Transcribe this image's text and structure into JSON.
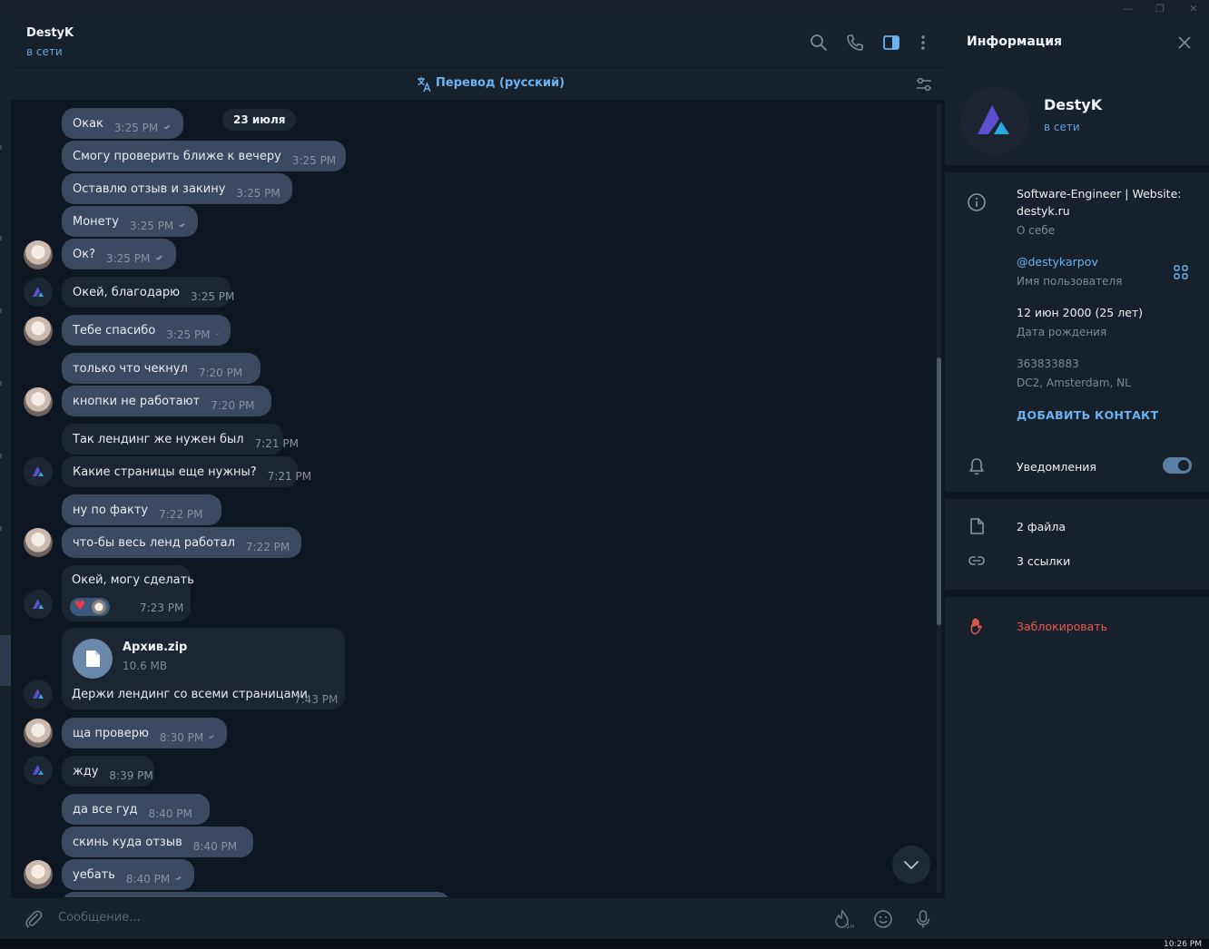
{
  "window": {
    "minimize": "—",
    "restore": "❐",
    "close": "✕"
  },
  "chat": {
    "title": "DestyK",
    "status": "в сети",
    "translate_label": "Перевод (русский)",
    "date_label": "23 июля"
  },
  "messages": [
    {
      "text": "Окак",
      "time": "3:25 PM"
    },
    {
      "text": "Смогу проверить ближе к вечеру",
      "time": "3:25 PM"
    },
    {
      "text": "Оставлю отзыв и закину",
      "time": "3:25 PM"
    },
    {
      "text": "Монету",
      "time": "3:25 PM"
    },
    {
      "text": "Ок?",
      "time": "3:25 PM"
    },
    {
      "text": "Окей, благодарю",
      "time": "3:25 PM"
    },
    {
      "text": "Тебе спасибо",
      "time": "3:25 PM"
    },
    {
      "text": "только что чекнул",
      "time": "7:20 PM"
    },
    {
      "text": "кнопки не работают",
      "time": "7:20 PM"
    },
    {
      "text": "Так лендинг же нужен был",
      "time": "7:21 PM"
    },
    {
      "text": "Какие страницы еще нужны?",
      "time": "7:21 PM"
    },
    {
      "text": "ну по факту",
      "time": "7:22 PM"
    },
    {
      "text": "что-бы весь ленд работал",
      "time": "7:22 PM"
    },
    {
      "text": "Окей, могу сделать",
      "time": "7:23 PM"
    },
    {
      "text": "ща проверю",
      "time": "8:30 PM"
    },
    {
      "text": "жду",
      "time": "8:39 PM"
    },
    {
      "text": "да все гуд",
      "time": "8:40 PM"
    },
    {
      "text": "скинь куда отзыв",
      "time": "8:40 PM"
    },
    {
      "text": "уебать",
      "time": "8:40 PM"
    }
  ],
  "file": {
    "name": "Архив.zip",
    "size": "10.6 MB",
    "caption": "Держи лендинг со всеми страницами",
    "time": "7:43 PM"
  },
  "composer": {
    "placeholder": "Сообщение..."
  },
  "clock": "10:26 PM",
  "info": {
    "title": "Информация",
    "name": "DestyK",
    "status": "в сети",
    "bio": "Software-Engineer | Website: destyk.ru",
    "bio_line1": "Software-Engineer | Website:",
    "bio_line2": "destyk.ru",
    "bio_label": "О себе",
    "username": "@destykarpov",
    "username_label": "Имя пользователя",
    "birthday": "12 июн 2000 (25 лет)",
    "birthday_label": "Дата рождения",
    "id": "363833883",
    "dc": "DC2, Amsterdam, NL",
    "add_contact": "ДОБАВИТЬ КОНТАКТ",
    "notifications": "Уведомления",
    "notifications_on": true,
    "files": "2 файла",
    "links": "3 ссылки",
    "block": "Заблокировать"
  },
  "colors": {
    "accent": "#6ab3f3",
    "outgoing_bubble": "#3a4a62",
    "incoming_bubble": "#1c2633",
    "danger": "#e8594f"
  }
}
